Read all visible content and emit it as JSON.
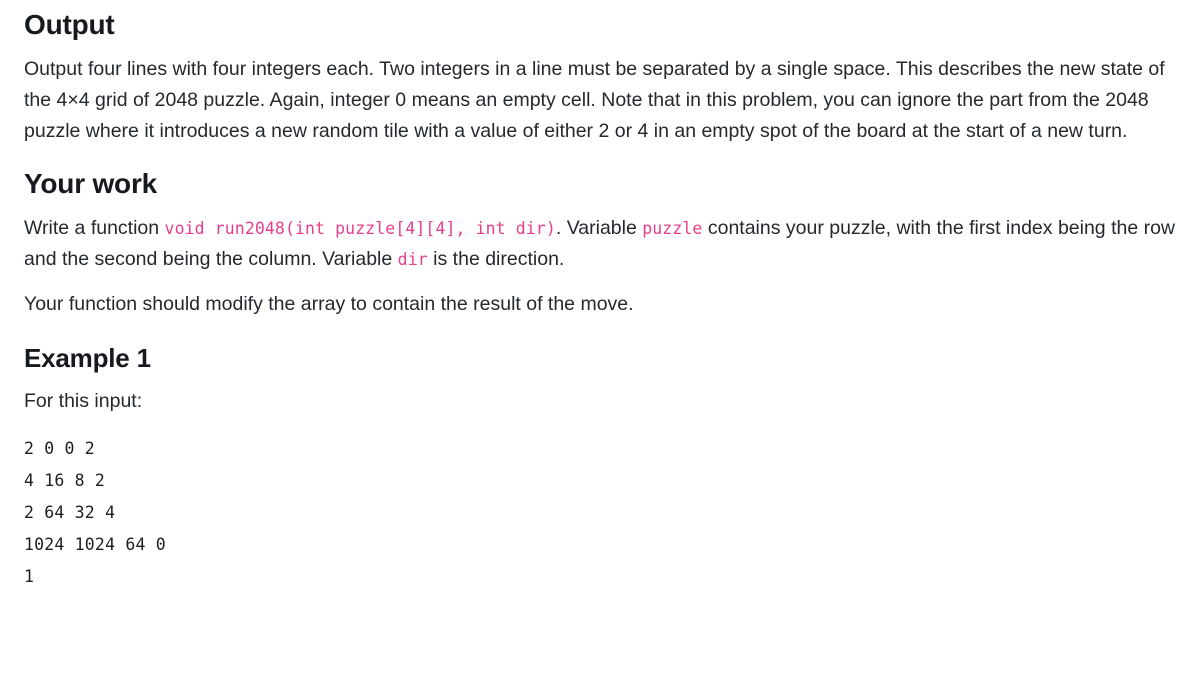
{
  "document": {
    "sections": [
      {
        "heading": "Output",
        "paragraphs": [
          "Output four lines with four integers each. Two integers in a line must be separated by a single space. This describes the new state of the 4×4 grid of 2048 puzzle. Again, integer 0 means an empty cell. Note that in this problem, you can ignore the part from the 2048 puzzle where it introduces a new random tile with a value of either 2 or 4 in an empty spot of the board at the start of a new turn."
        ]
      },
      {
        "heading": "Your work",
        "work_paragraph": {
          "lead": "Write a function ",
          "code_signature": "void run2048(int puzzle[4][4], int dir)",
          "mid_1": ". Variable ",
          "code_puzzle": "puzzle",
          "mid_2": " contains your puzzle, with the first index being the row and the second being the column. Variable ",
          "code_dir": "dir",
          "tail": " is the direction."
        },
        "paragraphs": [
          "Your function should modify the array to contain the result of the move."
        ]
      },
      {
        "heading": "Example 1",
        "paragraphs": [
          "For this input:"
        ],
        "code_block": "2 0 0 2\n4 16 8 2\n2 64 32 4\n1024 1024 64 0\n1"
      }
    ],
    "colors": {
      "inline_code": "#e83e8c",
      "body_text": "#24292e",
      "heading_text": "#16191d",
      "background": "#ffffff"
    }
  }
}
